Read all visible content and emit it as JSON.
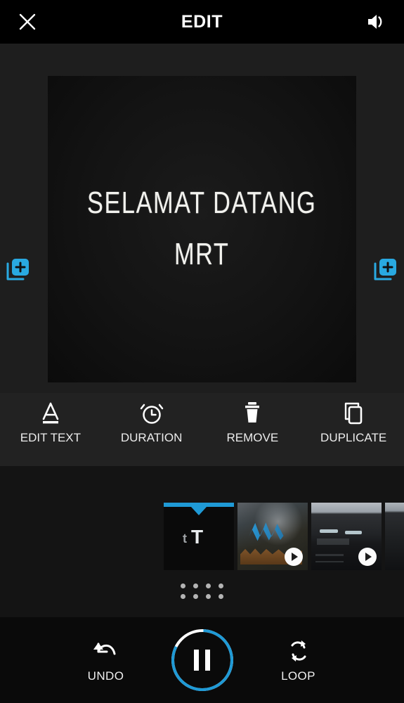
{
  "header": {
    "title": "EDIT",
    "close_icon": "close-icon",
    "sound_icon": "speaker-icon"
  },
  "preview": {
    "line1": "SELAMAT  DATANG",
    "line2": "MRT",
    "add_left_icon": "add-media-icon",
    "add_right_icon": "add-media-icon"
  },
  "toolbar": {
    "items": [
      {
        "label": "EDIT TEXT",
        "icon": "text-format-icon",
        "name": "edit-text"
      },
      {
        "label": "DURATION",
        "icon": "alarm-clock-icon",
        "name": "duration"
      },
      {
        "label": "REMOVE",
        "icon": "trash-icon",
        "name": "remove"
      },
      {
        "label": "DUPLICATE",
        "icon": "copy-icon",
        "name": "duplicate"
      }
    ]
  },
  "timeline": {
    "clips": [
      {
        "type": "text",
        "label": "tT",
        "selected": true,
        "has_play": false
      },
      {
        "type": "video",
        "label": "",
        "selected": false,
        "has_play": true
      },
      {
        "type": "video",
        "label": "",
        "selected": false,
        "has_play": true
      },
      {
        "type": "video",
        "label": "",
        "selected": false,
        "has_play": false
      }
    ],
    "drag_handle_icon": "drag-handle-dots-icon"
  },
  "bottom": {
    "undo_label": "UNDO",
    "undo_icon": "undo-arrow-icon",
    "loop_label": "LOOP",
    "loop_icon": "loop-repeat-icon",
    "play_state_icon": "pause-icon",
    "progress_percent": 82
  },
  "colors": {
    "accent": "#1f9ad6",
    "header_bg": "#000000",
    "app_bg": "#1d1d1d",
    "toolbar_bg": "#222222",
    "timeline_bg": "#141414",
    "bottom_bg": "#0a0a0a",
    "text": "#efefef"
  }
}
